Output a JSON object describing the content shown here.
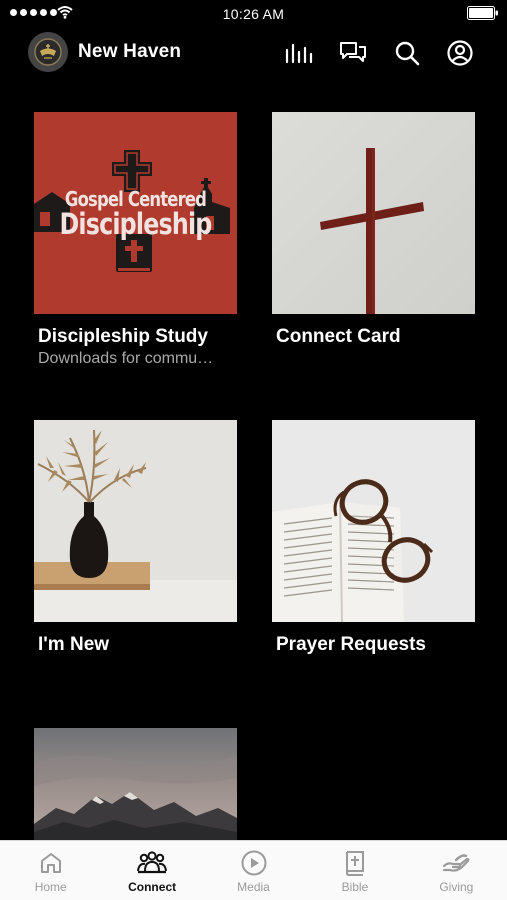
{
  "status_bar": {
    "time": "10:26 AM"
  },
  "header": {
    "church_name": "New Haven"
  },
  "cards": [
    {
      "title": "Discipleship Study",
      "subtitle": "Downloads for commu…",
      "image": {
        "line1": "Gospel Centered",
        "line2": "Discipleship"
      }
    },
    {
      "title": "Connect Card"
    },
    {
      "title": "I'm New"
    },
    {
      "title": "Prayer Requests"
    }
  ],
  "tabbar": {
    "tabs": [
      {
        "label": "Home",
        "icon": "home-icon"
      },
      {
        "label": "Connect",
        "icon": "people-icon",
        "active": true
      },
      {
        "label": "Media",
        "icon": "play-icon"
      },
      {
        "label": "Bible",
        "icon": "bible-icon"
      },
      {
        "label": "Giving",
        "icon": "giving-icon"
      }
    ]
  },
  "colors": {
    "background": "#000000",
    "accent_red": "#b03a2e",
    "tabbar_bg": "#fafafa"
  }
}
